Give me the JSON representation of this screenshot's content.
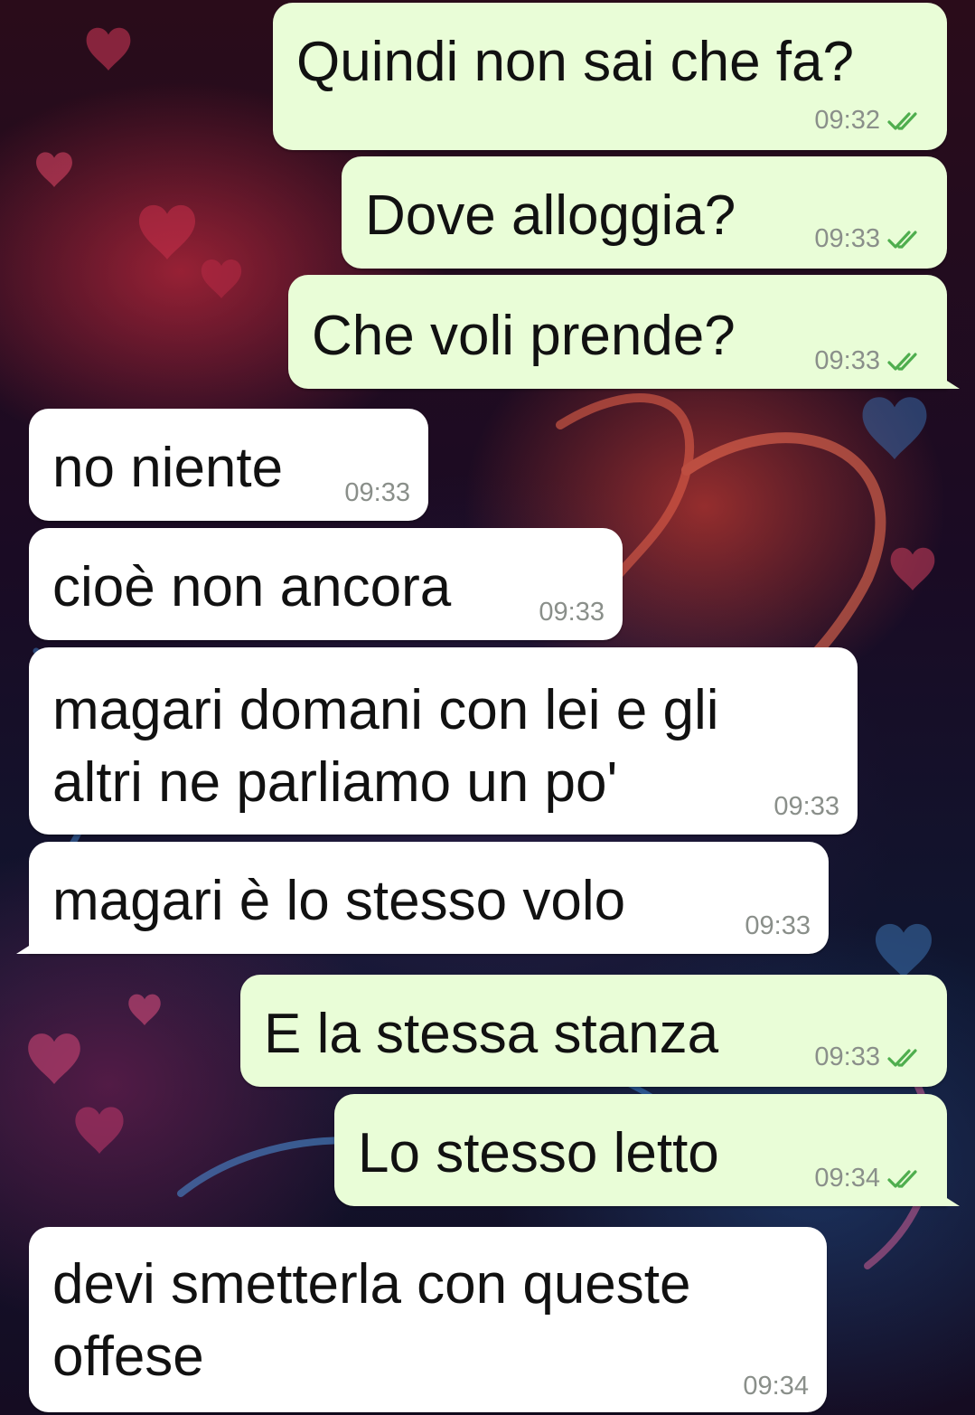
{
  "conversation": {
    "messages": [
      {
        "direction": "outgoing",
        "text": "Quindi non sai che fa?",
        "time": "09:32",
        "status": "read"
      },
      {
        "direction": "outgoing",
        "text": "Dove alloggia?",
        "time": "09:33",
        "status": "read"
      },
      {
        "direction": "outgoing",
        "text": "Che voli prende?",
        "time": "09:33",
        "status": "read"
      },
      {
        "direction": "incoming",
        "text": "no niente",
        "time": "09:33"
      },
      {
        "direction": "incoming",
        "text": "cioè non ancora",
        "time": "09:33"
      },
      {
        "direction": "incoming",
        "text_line1": "magari domani con lei e gli",
        "text_line2": "altri ne parliamo un po'",
        "time": "09:33"
      },
      {
        "direction": "incoming",
        "text": "magari è lo stesso volo",
        "time": "09:33"
      },
      {
        "direction": "outgoing",
        "text": "E la stessa stanza",
        "time": "09:33",
        "status": "read"
      },
      {
        "direction": "outgoing",
        "text": "Lo stesso letto",
        "time": "09:34",
        "status": "read"
      },
      {
        "direction": "incoming",
        "text_line1": "devi smetterla con queste",
        "text_line2": "offese",
        "time": "09:34"
      }
    ]
  },
  "colors": {
    "outgoing_bubble": "#e9fdd7",
    "incoming_bubble": "#ffffff",
    "read_receipt": "#4fae4e",
    "timestamp": "#8a8f8a"
  },
  "icons": {
    "read_receipt": "double-check-icon",
    "wallpaper": "hearts-wallpaper"
  }
}
